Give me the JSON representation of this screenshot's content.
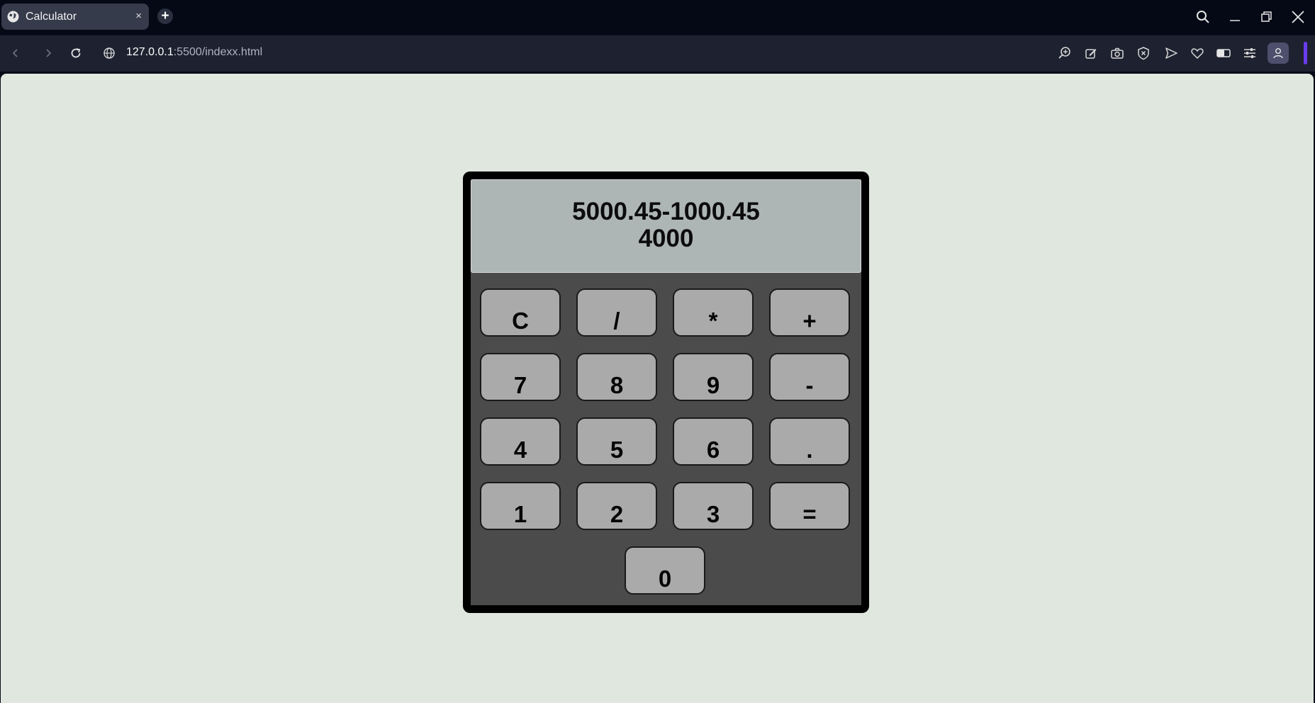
{
  "browser": {
    "tab_title": "Calculator",
    "tab_close": "×",
    "new_tab": "+",
    "url_host": "127.0.0.1",
    "url_path": ":5500/indexx.html"
  },
  "calculator": {
    "expression": "5000.45-1000.45",
    "result": "4000",
    "buttons": {
      "clear": "C",
      "divide": "/",
      "multiply": "*",
      "add": "+",
      "seven": "7",
      "eight": "8",
      "nine": "9",
      "subtract": "-",
      "four": "4",
      "five": "5",
      "six": "6",
      "decimal": ".",
      "one": "1",
      "two": "2",
      "three": "3",
      "equals": "=",
      "zero": "0"
    }
  },
  "colors": {
    "page_background": "#e0e7df",
    "calculator_body": "#4b4b4b",
    "display_background": "#aeb5b5",
    "button_face": "#aaaaaa",
    "accent": "#6a3cf0"
  },
  "icons": [
    "globe-icon",
    "search-icon",
    "minimize-icon",
    "restore-icon",
    "close-icon",
    "back-icon",
    "forward-icon",
    "reload-icon",
    "site-info-icon",
    "zoom-icon",
    "edit-icon",
    "camera-icon",
    "shield-icon",
    "send-icon",
    "heart-icon",
    "toggle-icon",
    "sliders-icon",
    "profile-icon"
  ]
}
